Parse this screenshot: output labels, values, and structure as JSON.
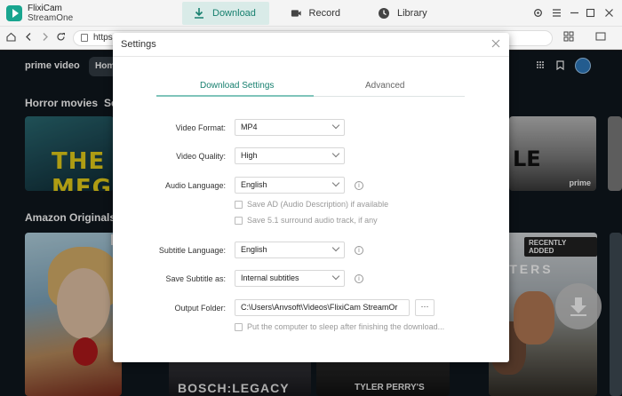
{
  "app": {
    "name": "FlixiCam",
    "sub": "StreamOne"
  },
  "tabs": {
    "download": "Download",
    "record": "Record",
    "library": "Library"
  },
  "browser": {
    "url": "https"
  },
  "prime": {
    "logo": "prime video",
    "home": "Hom",
    "row1_title": "Horror movies",
    "row1_tail": "Se",
    "row2_title": "Amazon Originals a",
    "meg": "THE MEG",
    "bw_text": "LE",
    "prime_tag": "prime",
    "kid_corner": "N",
    "recently_added": "RECENTLY ADDED",
    "twisters": "ISTERS",
    "bosch": "BOSCH:LEGACY",
    "tyler": "TYLER PERRY'S"
  },
  "dialog": {
    "title": "Settings",
    "tab_download": "Download Settings",
    "tab_advanced": "Advanced",
    "video_format_label": "Video Format:",
    "video_format_value": "MP4",
    "video_quality_label": "Video Quality:",
    "video_quality_value": "High",
    "audio_language_label": "Audio Language:",
    "audio_language_value": "English",
    "save_ad_label": "Save AD (Audio Description) if available",
    "save_51_label": "Save 5.1 surround audio track, if any",
    "subtitle_language_label": "Subtitle Language:",
    "subtitle_language_value": "English",
    "save_subtitle_label": "Save Subtitle as:",
    "save_subtitle_value": "Internal subtitles",
    "output_folder_label": "Output Folder:",
    "output_folder_value": "C:\\Users\\Anvsoft\\Videos\\FlixiCam StreamOr",
    "browse_label": "···",
    "sleep_label": "Put the computer to sleep after finishing the download..."
  },
  "colors": {
    "accent": "#17806f",
    "accent_light": "#d9ebe8",
    "prime_bg": "#0f171e"
  }
}
